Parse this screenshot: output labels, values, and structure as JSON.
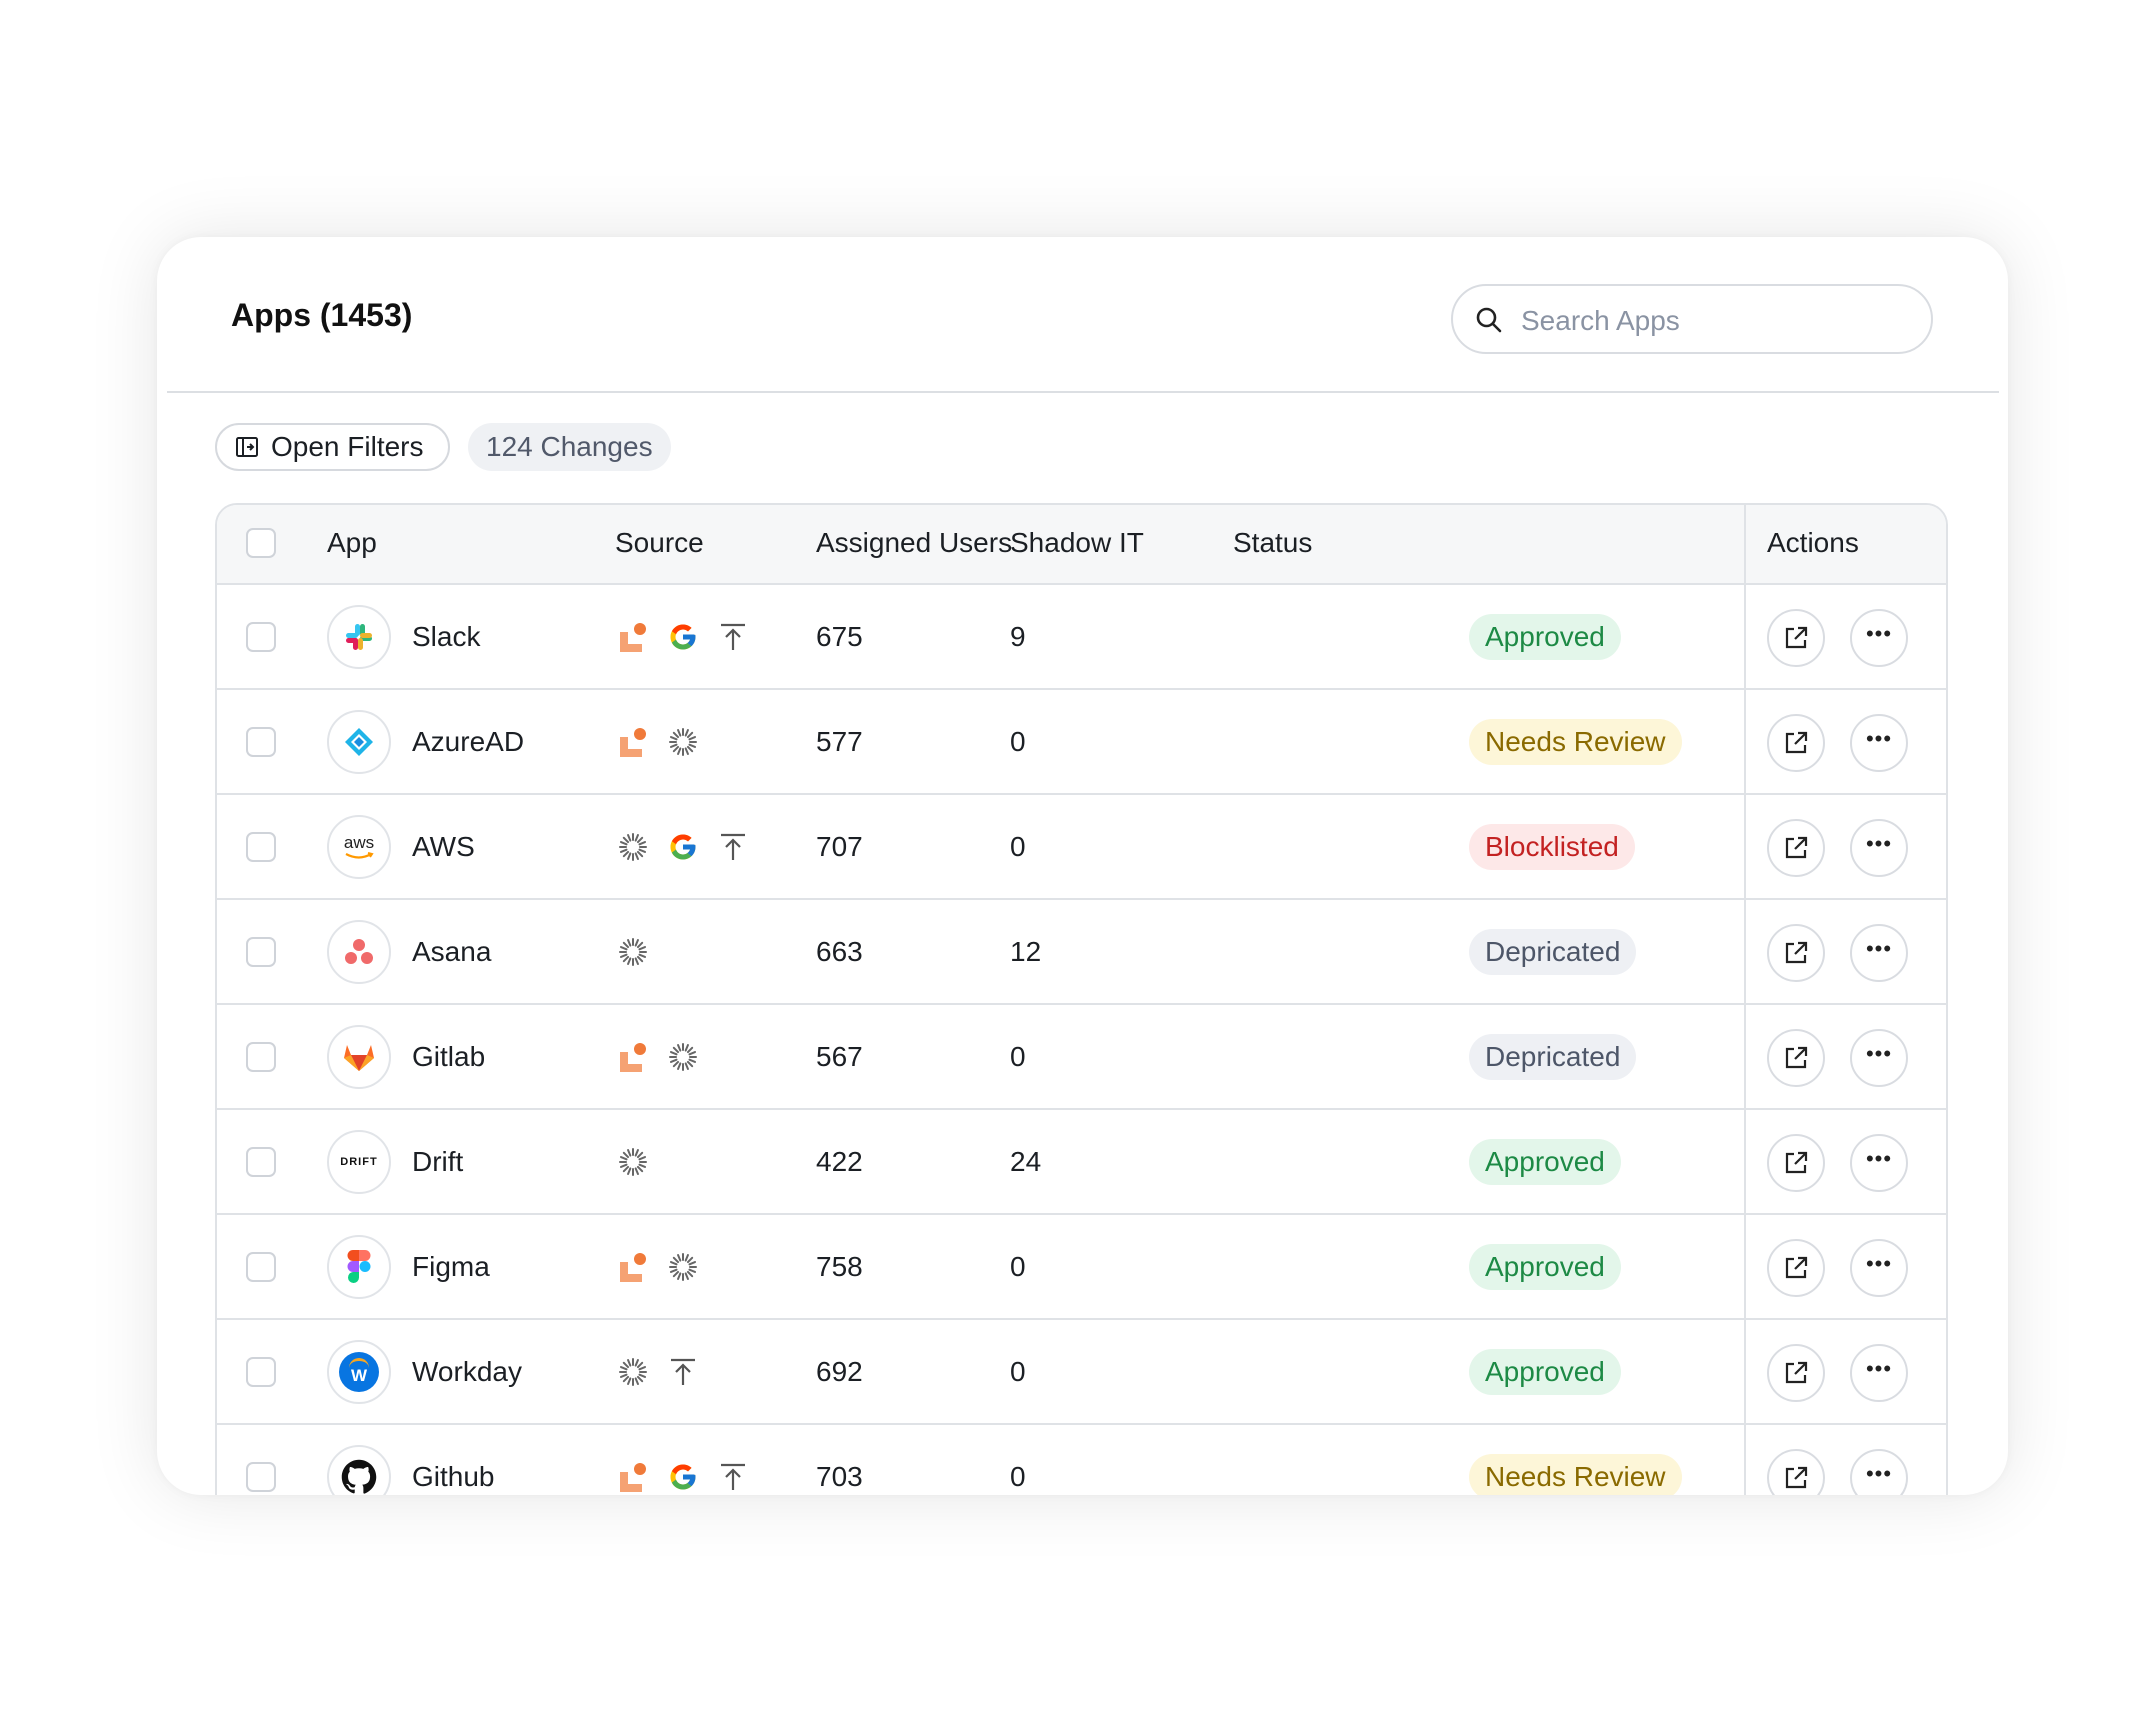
{
  "header": {
    "title": "Apps (1453)",
    "search_placeholder": "Search Apps"
  },
  "toolbar": {
    "open_filters_label": "Open Filters",
    "changes_label": "124 Changes"
  },
  "table": {
    "columns": {
      "app": "App",
      "source": "Source",
      "assigned_users": "Assigned Users",
      "shadow_it": "Shadow IT",
      "status": "Status",
      "actions": "Actions"
    },
    "rows": [
      {
        "name": "Slack",
        "logo": "slack-logo",
        "sources": [
          "orange-source-icon",
          "google-icon",
          "upload-icon"
        ],
        "assigned_users": "675",
        "shadow_it": "9",
        "status": "Approved",
        "status_kind": "approved"
      },
      {
        "name": "AzureAD",
        "logo": "azuread-logo",
        "sources": [
          "orange-source-icon",
          "sync-spinner-icon"
        ],
        "assigned_users": "577",
        "shadow_it": "0",
        "status": "Needs Review",
        "status_kind": "review"
      },
      {
        "name": "AWS",
        "logo": "aws-logo",
        "sources": [
          "sync-spinner-icon",
          "google-icon",
          "upload-icon"
        ],
        "assigned_users": "707",
        "shadow_it": "0",
        "status": "Blocklisted",
        "status_kind": "block"
      },
      {
        "name": "Asana",
        "logo": "asana-logo",
        "sources": [
          "sync-spinner-icon"
        ],
        "assigned_users": "663",
        "shadow_it": "12",
        "status": "Depricated",
        "status_kind": "dep"
      },
      {
        "name": "Gitlab",
        "logo": "gitlab-logo",
        "sources": [
          "orange-source-icon",
          "sync-spinner-icon"
        ],
        "assigned_users": "567",
        "shadow_it": "0",
        "status": "Depricated",
        "status_kind": "dep"
      },
      {
        "name": "Drift",
        "logo": "drift-logo",
        "sources": [
          "sync-spinner-icon"
        ],
        "assigned_users": "422",
        "shadow_it": "24",
        "status": "Approved",
        "status_kind": "approved"
      },
      {
        "name": "Figma",
        "logo": "figma-logo",
        "sources": [
          "orange-source-icon",
          "sync-spinner-icon"
        ],
        "assigned_users": "758",
        "shadow_it": "0",
        "status": "Approved",
        "status_kind": "approved"
      },
      {
        "name": "Workday",
        "logo": "workday-logo",
        "sources": [
          "sync-spinner-icon",
          "upload-icon"
        ],
        "assigned_users": "692",
        "shadow_it": "0",
        "status": "Approved",
        "status_kind": "approved"
      },
      {
        "name": "Github",
        "logo": "github-logo",
        "sources": [
          "orange-source-icon",
          "google-icon",
          "upload-icon"
        ],
        "assigned_users": "703",
        "shadow_it": "0",
        "status": "Needs Review",
        "status_kind": "review"
      }
    ]
  },
  "aws_logo_text": "aws",
  "drift_logo_text": "DRIFT",
  "workday_logo_text": "W",
  "colors": {
    "approved": "#1d8a45",
    "review": "#8a6a00",
    "blocklisted": "#c32222",
    "depricated": "#4d5668",
    "source_orange": "#f5a273"
  }
}
